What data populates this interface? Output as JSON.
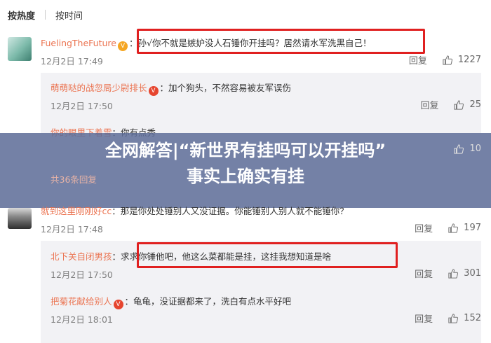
{
  "sortbar": {
    "hot": "按热度",
    "time": "按时间"
  },
  "comments": [
    {
      "user": "FuelingTheFuture",
      "text": "：孙√你不就是嫉妒没人石锤你开挂吗？居然请水军洗黑自己！",
      "time": "12月2日 17:49",
      "reply_label": "回复",
      "likes": "1227"
    },
    {
      "user": "萌萌哒的战忽局少尉排长",
      "text": "：加个狗头，不然容易被友军误伤",
      "time": "12月2日 17:50",
      "reply_label": "回复",
      "likes": "25"
    },
    {
      "user": "你的眼里下着雪",
      "text": "：你有点秀",
      "time": "",
      "reply_label": "",
      "likes": "10"
    },
    {
      "total_replies": "共36条回复"
    },
    {
      "user": "就到这里刚刚好cc",
      "text": "：那是你处处锤别人又没证据。你能锤别人别人就不能锤你？",
      "time": "12月2日 17:48",
      "reply_label": "回复",
      "likes": "197"
    },
    {
      "user": "北下关自闭男孩",
      "text": "：求求你锤他吧，他这么菜都能是挂，这挂我想知道是啥",
      "time": "12月2日 17:50",
      "reply_label": "回复",
      "likes": "301"
    },
    {
      "user": "把菊花献给别人",
      "text": "：龟龟，没证据都来了，洗白有点水平好吧",
      "time": "12月2日 18:01",
      "reply_label": "回复",
      "likes": "152"
    }
  ],
  "banner": {
    "line1": "全网解答|“新世界有挂吗可以开挂吗”",
    "line2": "事实上确实有挂"
  },
  "colors": {
    "username": "#eb7350",
    "highlight_box": "#e02020",
    "banner_bg": "#5c6b96"
  },
  "icons": {
    "like": "thumbs-up-icon",
    "vip": "vip-badge-icon"
  }
}
